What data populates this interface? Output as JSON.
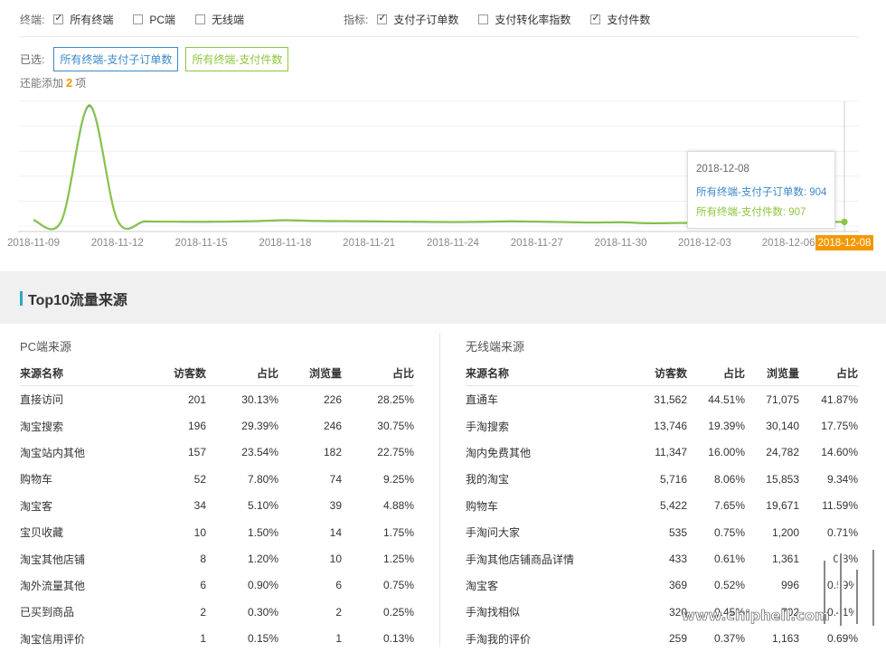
{
  "filters": {
    "terminal_label": "终端:",
    "terminals": [
      {
        "label": "所有终端",
        "checked": true
      },
      {
        "label": "PC端",
        "checked": false
      },
      {
        "label": "无线端",
        "checked": false
      }
    ],
    "metric_label": "指标:",
    "metrics": [
      {
        "label": "支付子订单数",
        "checked": true
      },
      {
        "label": "支付转化率指数",
        "checked": false
      },
      {
        "label": "支付件数",
        "checked": true
      }
    ]
  },
  "selected": {
    "label": "已选:",
    "tags": [
      "所有终端-支付子订单数",
      "所有终端-支付件数"
    ]
  },
  "add_more": {
    "prefix": "还能添加",
    "count": "2",
    "suffix": "项"
  },
  "colors": {
    "blue": "#3c89c9",
    "green": "#8dc63f",
    "orange": "#f39800",
    "accent_bar": "#2aa7c9"
  },
  "chart_data": {
    "type": "line",
    "x": [
      "2018-11-09",
      "2018-11-10",
      "2018-11-11",
      "2018-11-12",
      "2018-11-13",
      "2018-11-14",
      "2018-11-15",
      "2018-11-16",
      "2018-11-17",
      "2018-11-18",
      "2018-11-19",
      "2018-11-20",
      "2018-11-21",
      "2018-11-22",
      "2018-11-23",
      "2018-11-24",
      "2018-11-25",
      "2018-11-26",
      "2018-11-27",
      "2018-11-28",
      "2018-11-29",
      "2018-11-30",
      "2018-12-01",
      "2018-12-02",
      "2018-12-03",
      "2018-12-04",
      "2018-12-05",
      "2018-12-06",
      "2018-12-07",
      "2018-12-08"
    ],
    "tick_labels": [
      "2018-11-09",
      "2018-11-12",
      "2018-11-15",
      "2018-11-18",
      "2018-11-21",
      "2018-11-24",
      "2018-11-27",
      "2018-11-30",
      "2018-12-03",
      "2018-12-06"
    ],
    "highlight_label": "2018-12-08",
    "ylim": [
      0,
      27000
    ],
    "series": [
      {
        "name": "所有终端-支付子订单数",
        "color": "#3c89c9",
        "values": [
          1300,
          1100,
          26000,
          1300,
          1000,
          950,
          900,
          950,
          1050,
          1250,
          1100,
          1050,
          1000,
          950,
          900,
          850,
          900,
          1000,
          950,
          850,
          750,
          800,
          600,
          650,
          750,
          700,
          800,
          850,
          900,
          904
        ]
      },
      {
        "name": "所有终端-支付件数",
        "color": "#8dc63f",
        "values": [
          1350,
          1150,
          26200,
          1350,
          1050,
          980,
          950,
          1000,
          1100,
          1300,
          1150,
          1100,
          1050,
          1000,
          950,
          900,
          950,
          1050,
          1000,
          900,
          800,
          850,
          650,
          700,
          800,
          750,
          850,
          880,
          900,
          907
        ]
      }
    ],
    "grid": true
  },
  "tooltip": {
    "date": "2018-12-08",
    "line1": "所有终端-支付子订单数: 904",
    "line2": "所有终端-支付件数: 907"
  },
  "section_title": "Top10流量来源",
  "pc": {
    "title": "PC端来源",
    "headers": [
      "来源名称",
      "访客数",
      "占比",
      "浏览量",
      "占比"
    ],
    "rows": [
      [
        "直接访问",
        "201",
        "30.13%",
        "226",
        "28.25%"
      ],
      [
        "淘宝搜索",
        "196",
        "29.39%",
        "246",
        "30.75%"
      ],
      [
        "淘宝站内其他",
        "157",
        "23.54%",
        "182",
        "22.75%"
      ],
      [
        "购物车",
        "52",
        "7.80%",
        "74",
        "9.25%"
      ],
      [
        "淘宝客",
        "34",
        "5.10%",
        "39",
        "4.88%"
      ],
      [
        "宝贝收藏",
        "10",
        "1.50%",
        "14",
        "1.75%"
      ],
      [
        "淘宝其他店铺",
        "8",
        "1.20%",
        "10",
        "1.25%"
      ],
      [
        "淘外流量其他",
        "6",
        "0.90%",
        "6",
        "0.75%"
      ],
      [
        "已买到商品",
        "2",
        "0.30%",
        "2",
        "0.25%"
      ],
      [
        "淘宝信用评价",
        "1",
        "0.15%",
        "1",
        "0.13%"
      ]
    ]
  },
  "mobile": {
    "title": "无线端来源",
    "headers": [
      "来源名称",
      "访客数",
      "占比",
      "浏览量",
      "占比"
    ],
    "rows": [
      [
        "直通车",
        "31,562",
        "44.51%",
        "71,075",
        "41.87%"
      ],
      [
        "手淘搜索",
        "13,746",
        "19.39%",
        "30,140",
        "17.75%"
      ],
      [
        "淘内免费其他",
        "11,347",
        "16.00%",
        "24,782",
        "14.60%"
      ],
      [
        "我的淘宝",
        "5,716",
        "8.06%",
        "15,853",
        "9.34%"
      ],
      [
        "购物车",
        "5,422",
        "7.65%",
        "19,671",
        "11.59%"
      ],
      [
        "手淘问大家",
        "535",
        "0.75%",
        "1,200",
        "0.71%"
      ],
      [
        "手淘其他店铺商品详情",
        "433",
        "0.61%",
        "1,361",
        "0.8%"
      ],
      [
        "淘宝客",
        "369",
        "0.52%",
        "996",
        "0.59%"
      ],
      [
        "手淘找相似",
        "320",
        "0.45%",
        "702",
        "0.41%"
      ],
      [
        "手淘我的评价",
        "259",
        "0.37%",
        "1,163",
        "0.69%"
      ]
    ]
  },
  "watermark": {
    "text": "www.chiphell.com",
    "logo": "chip hell"
  }
}
